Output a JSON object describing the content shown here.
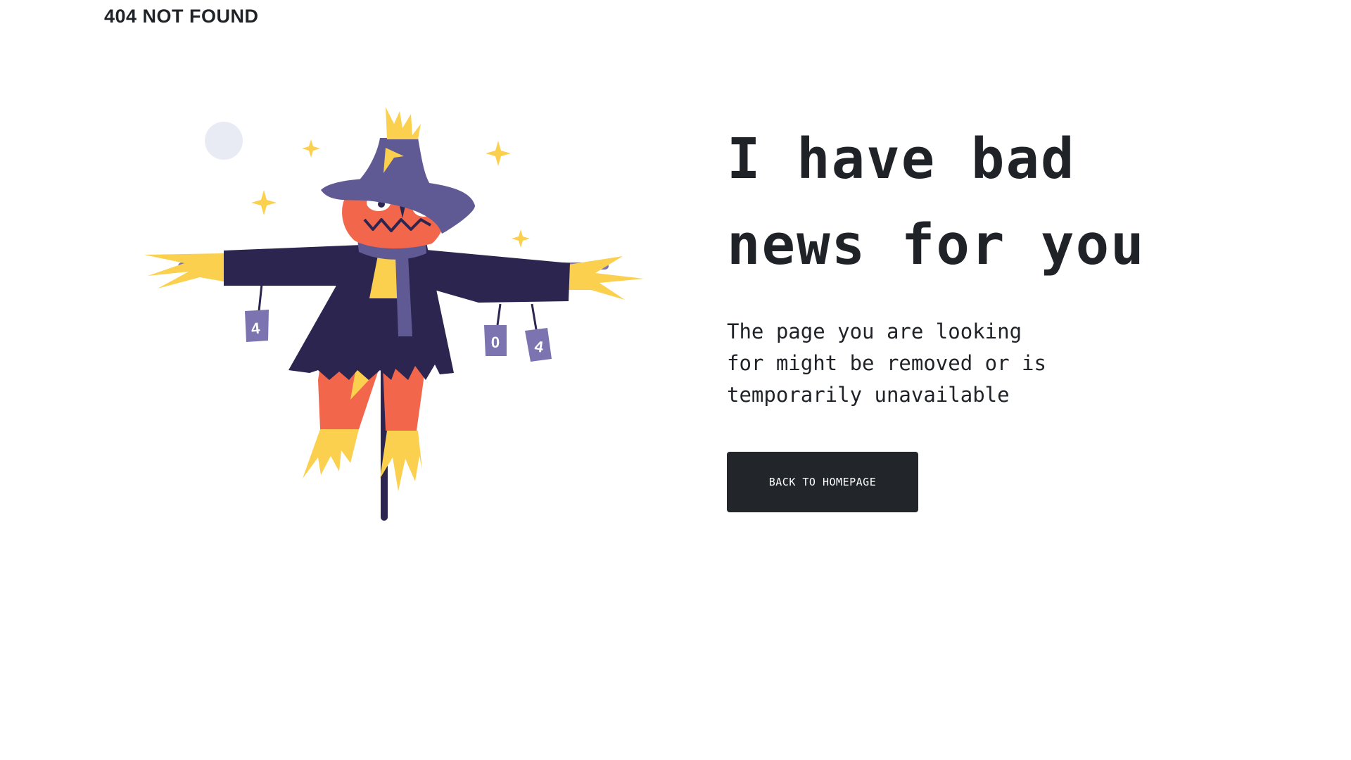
{
  "header": {
    "brand": "404 NOT FOUND"
  },
  "main": {
    "headline": "I have bad news for you",
    "message": "The page you are looking for might be removed or is temporarily unavailable",
    "cta_label": "BACK TO HOMEPAGE"
  },
  "illustration": {
    "can_1": "4",
    "can_2": "0",
    "can_3": "4"
  },
  "colors": {
    "dark": "#22252a",
    "coat": "#2b2550",
    "hat": "#5f5a94",
    "can": "#7b74b0",
    "face": "#f2664b",
    "straw": "#fbd04e",
    "moon": "#e8ebf4"
  }
}
